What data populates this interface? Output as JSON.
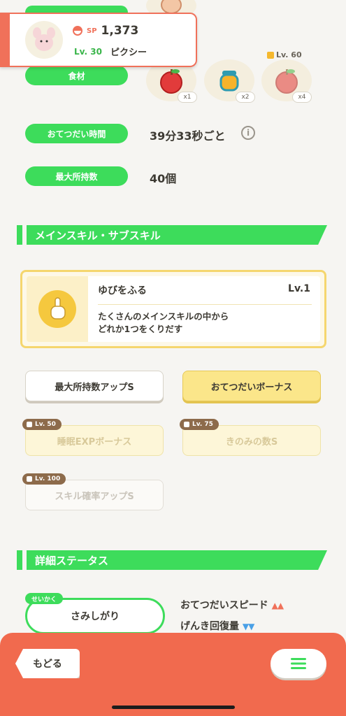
{
  "pokemon": {
    "sp_label": "SP",
    "sp_value": "1,373",
    "level": "Lv. 30",
    "name": "ピクシー"
  },
  "rows": {
    "ingredients_label": "食材",
    "help_time_label": "おてつだい時間",
    "help_time_value": "39分33秒ごと",
    "info_icon": "i",
    "max_carry_label": "最大所持数",
    "max_carry_value": "40個"
  },
  "ingredients": [
    {
      "name": "apple",
      "qty": "x1"
    },
    {
      "name": "honey",
      "qty": "x2"
    },
    {
      "name": "apple-locked",
      "qty": "x4",
      "lock_level": "Lv. 60"
    }
  ],
  "main_section": {
    "title": "メインスキル・サブスキル"
  },
  "main_skill": {
    "name": "ゆびをふる",
    "level": "Lv.1",
    "desc_line1": "たくさんのメインスキルの中から",
    "desc_line2": "どれか1つをくりだす"
  },
  "sub_skills": [
    {
      "label": "最大所持数アップS",
      "state": "unlocked-white"
    },
    {
      "label": "おてつだいボーナス",
      "state": "unlocked-yellow"
    },
    {
      "label": "睡眠EXPボーナス",
      "state": "locked",
      "lock_level": "Lv. 50"
    },
    {
      "label": "きのみの数S",
      "state": "locked",
      "lock_level": "Lv. 75"
    },
    {
      "label": "スキル確率アップS",
      "state": "locked",
      "lock_level": "Lv. 100"
    }
  ],
  "detail_section": {
    "title": "詳細ステータス"
  },
  "nature": {
    "tag": "せいかく",
    "value": "さみしがり",
    "up_label": "おてつだいスピード",
    "up_arrows": "▲▲",
    "down_label": "げんき回復量",
    "down_arrows": "▼▼"
  },
  "bottom": {
    "back_label": "もどる"
  },
  "colors": {
    "accent_green": "#3ddc5b",
    "accent_orange": "#f16a4e",
    "skill_yellow": "#f5c83e"
  }
}
